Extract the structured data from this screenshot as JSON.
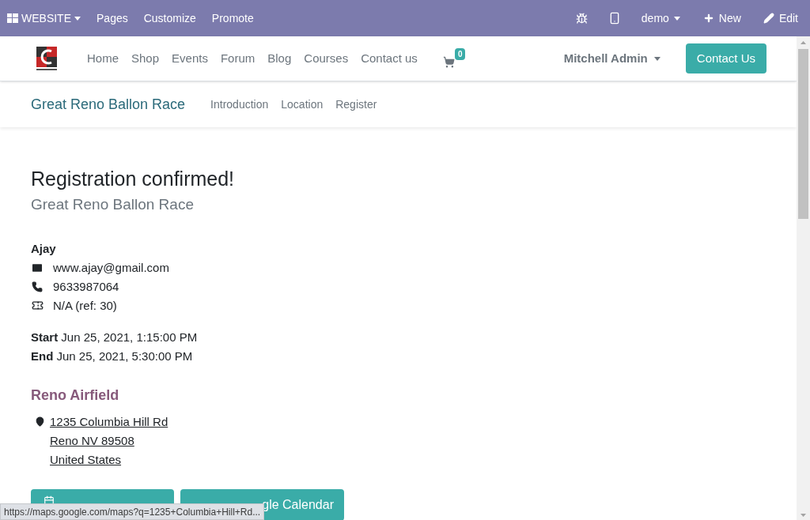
{
  "admin_bar": {
    "app": "WEBSITE",
    "menus": [
      "Pages",
      "Customize",
      "Promote"
    ],
    "user": "demo",
    "new": "New",
    "edit": "Edit"
  },
  "navbar": {
    "links": [
      "Home",
      "Shop",
      "Events",
      "Forum",
      "Blog",
      "Courses",
      "Contact us"
    ],
    "cart_count": "0",
    "user": "Mitchell Admin",
    "cta": "Contact Us"
  },
  "event_nav": {
    "title": "Great Reno Ballon Race",
    "links": [
      "Introduction",
      "Location",
      "Register"
    ]
  },
  "confirmation": {
    "heading": "Registration confirmed!",
    "event": "Great Reno Ballon Race",
    "attendee": "Ajay",
    "details": [
      {
        "kind": "email",
        "text": "www.ajay@gmail.com"
      },
      {
        "kind": "phone",
        "text": "9633987064"
      },
      {
        "kind": "ticket",
        "text": "N/A (ref: 30)"
      }
    ],
    "dates": [
      {
        "label": "Start",
        "value": "Jun 25, 2021, 1:15:00 PM"
      },
      {
        "label": "End",
        "value": "Jun 25, 2021, 5:30:00 PM"
      }
    ],
    "venue": "Reno Airfield",
    "address": [
      "1235 Columbia Hill Rd",
      "Reno NV 89508",
      "United States"
    ],
    "buttons": [
      {
        "kind": "hidden"
      },
      {
        "kind": "text",
        "text": "gle Calendar"
      }
    ]
  },
  "status_bar": "https://maps.google.com/maps?q=1235+Columbia+Hill+Rd..."
}
